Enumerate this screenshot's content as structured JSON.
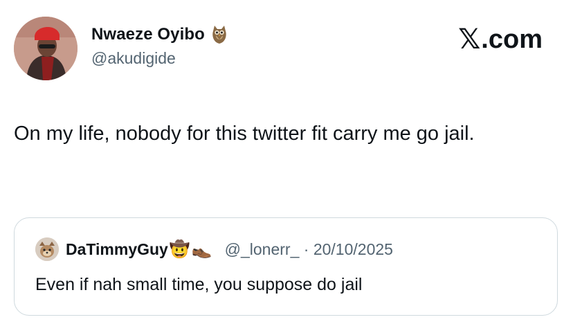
{
  "author": {
    "display_name": "Nwaeze Oyibo",
    "name_emoji": "owl-icon",
    "handle": "@akudigide",
    "avatar": "avatar"
  },
  "brand": {
    "label": "X.com",
    "mark": "𝕏",
    "suffix": ".com"
  },
  "tweet": {
    "text": "On my life, nobody for this twitter fit carry me go jail."
  },
  "quoted_tweet": {
    "display_name": "DaTimmyGuy",
    "emojis": [
      "cowboy-hat-face-icon",
      "shoe-icon"
    ],
    "emoji_glyphs": [
      "🤠",
      "👞"
    ],
    "handle": "@_lonerr_",
    "separator": "·",
    "date": "20/10/2025",
    "text": "Even if nah small time, you suppose do jail"
  }
}
